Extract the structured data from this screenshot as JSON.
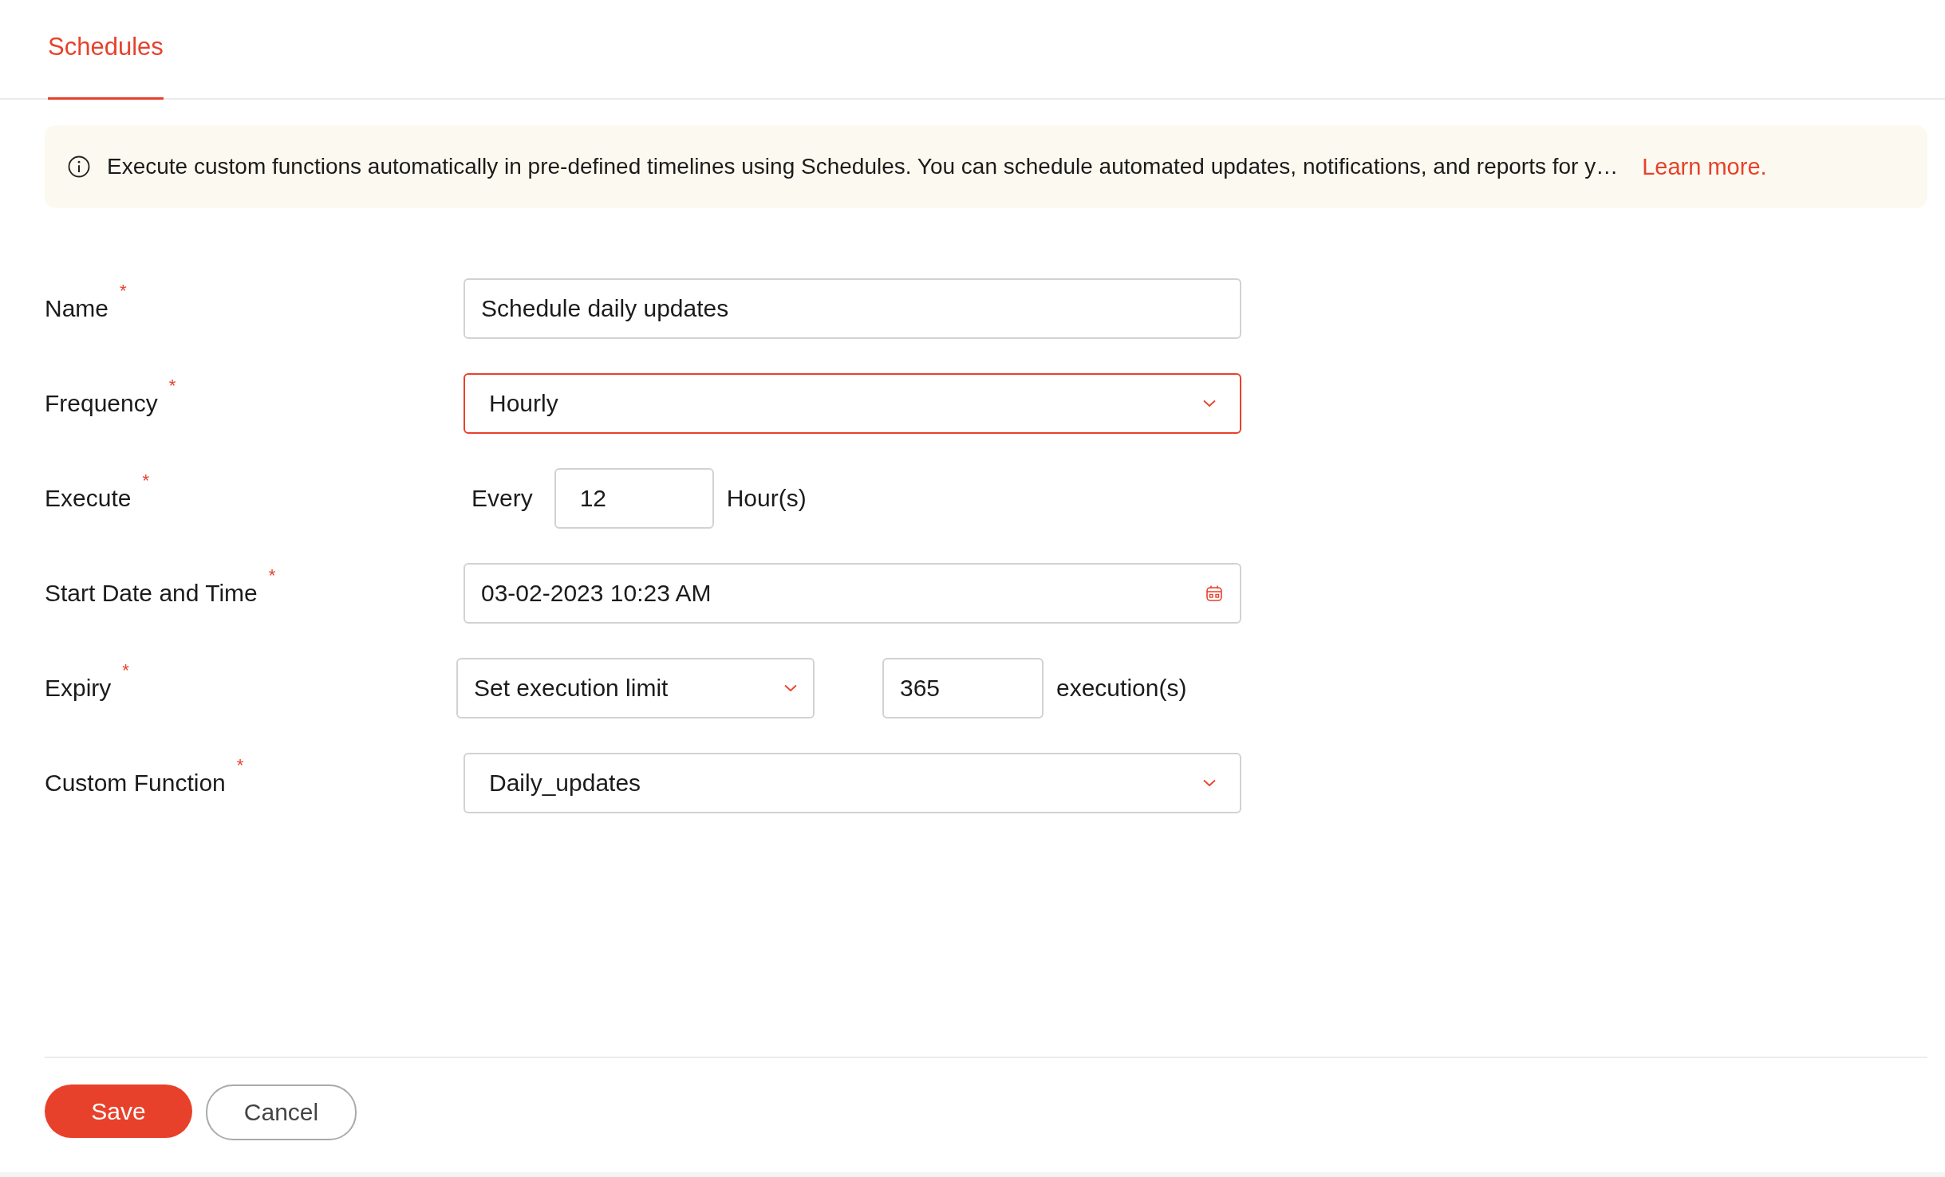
{
  "tabs": [
    {
      "label": "Schedules",
      "selected": true
    }
  ],
  "info_banner": {
    "text": "Execute custom functions automatically in pre-defined timelines using Schedules. You can schedule automated updates, notifications, and reports for y…",
    "link": "Learn more."
  },
  "fields": [
    {
      "kind": "text",
      "label": "Name",
      "required_mark": "*",
      "value": "Schedule daily updates",
      "focused": false
    },
    {
      "kind": "select",
      "label": "Frequency",
      "required_mark": "*",
      "value": "Hourly",
      "focused": true
    },
    {
      "kind": "interval",
      "label": "Execute",
      "required_mark": "*",
      "prefix": "Every",
      "value": "12",
      "suffix": "Hour(s)"
    },
    {
      "kind": "date",
      "label": "Start Date and Time",
      "required_mark": "*",
      "value": "03-02-2023 10:23 AM",
      "focused": false
    },
    {
      "kind": "limit",
      "label": "Expiry",
      "required_mark": "*",
      "option": "Set execution limit",
      "value": "365",
      "suffix": "execution(s)"
    },
    {
      "kind": "select",
      "label": "Custom Function",
      "required_mark": "*",
      "value": "Daily_updates",
      "focused": false
    }
  ],
  "buttons": [
    {
      "kind": "primary",
      "label": "Save"
    },
    {
      "kind": "secondary",
      "label": "Cancel"
    }
  ]
}
